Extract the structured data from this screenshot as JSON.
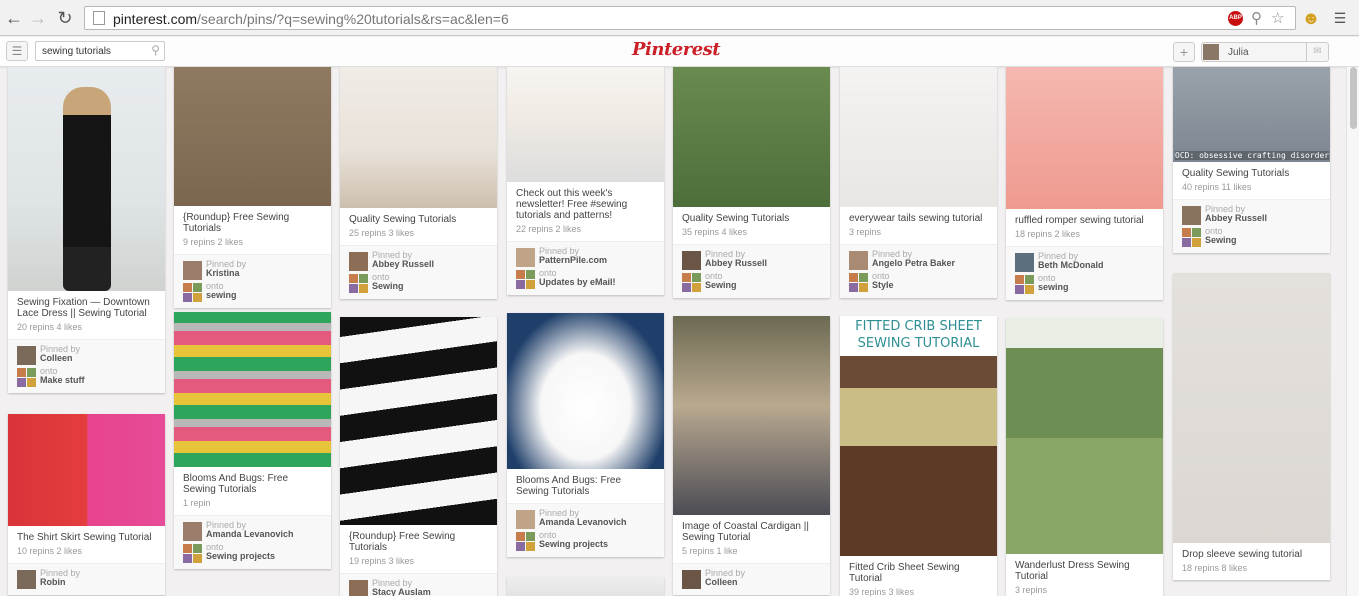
{
  "browser": {
    "url_host": "pinterest.com",
    "url_path": "/search/pins/?q=sewing%20tutorials&rs=ac&len=6",
    "adblock_badge": "ABP",
    "icons": [
      "back-arrow-icon",
      "forward-arrow-icon",
      "reload-icon",
      "page-icon",
      "adblock-icon",
      "search-engine-icon",
      "bookmark-star-icon",
      "extension-icon",
      "menu-icon"
    ]
  },
  "header": {
    "search_value": "sewing tutorials",
    "logo": "Pinterest",
    "user_name": "Julia"
  },
  "labels": {
    "pinned_by": "Pinned by",
    "onto": "onto"
  },
  "colors": {
    "brand": "#cb2027",
    "background": "#f2f0f0"
  },
  "columns": [
    [
      {
        "desc": "Sewing Fixation — Downtown Lace Dress || Sewing Tutorial",
        "stats": "20 repins   4 likes",
        "pinner": "Colleen",
        "board": "Make stuff"
      },
      {
        "desc": "The Shirt Skirt Sewing Tutorial",
        "stats": "10 repins   2 likes",
        "pinner": "Robin",
        "board": ""
      }
    ],
    [
      {
        "desc": "{Roundup} Free Sewing Tutorials",
        "stats": "9 repins   2 likes",
        "pinner": "Kristina",
        "board": "sewing"
      },
      {
        "desc": "Blooms And Bugs: Free Sewing Tutorials",
        "stats": "1 repin",
        "pinner": "Amanda Levanovich",
        "board": "Sewing projects"
      }
    ],
    [
      {
        "desc": "Quality Sewing Tutorials",
        "stats": "25 repins   3 likes",
        "pinner": "Abbey Russell",
        "board": "Sewing"
      },
      {
        "desc": "{Roundup} Free Sewing Tutorials",
        "stats": "19 repins   3 likes",
        "pinner": "Stacy Auslam",
        "board": ""
      }
    ],
    [
      {
        "desc": "Check out this week's newsletter! Free #sewing tutorials and patterns!",
        "stats": "22 repins   2 likes",
        "pinner": "PatternPile.com",
        "board": "Updates by eMail!"
      },
      {
        "desc": "Blooms And Bugs: Free Sewing Tutorials",
        "stats": "",
        "pinner": "Amanda Levanovich",
        "board": "Sewing projects"
      }
    ],
    [
      {
        "desc": "Quality Sewing Tutorials",
        "stats": "35 repins   4 likes",
        "pinner": "Abbey Russell",
        "board": "Sewing"
      },
      {
        "desc": "Image of Coastal Cardigan || Sewing Tutorial",
        "stats": "5 repins   1 like",
        "pinner": "Colleen",
        "board": ""
      }
    ],
    [
      {
        "desc": "everywear tails sewing tutorial",
        "stats": "3 repins",
        "pinner": "Angelo Petra Baker",
        "board": "Style"
      },
      {
        "desc": "Fitted Crib Sheet Sewing Tutorial",
        "stats": "39 repins   3 likes",
        "pinner": "",
        "board": "",
        "overlay_title": "FITTED CRIB SHEET SEWING TUTORIAL"
      }
    ],
    [
      {
        "desc": "ruffled romper sewing tutorial",
        "stats": "18 repins   2 likes",
        "pinner": "Beth McDonald",
        "board": "sewing"
      },
      {
        "desc": "Wanderlust Dress Sewing Tutorial",
        "stats": "3 repins",
        "pinner": "",
        "board": ""
      }
    ],
    [
      {
        "desc": "Quality Sewing Tutorials",
        "stats": "40 repins   11 likes",
        "pinner": "Abbey Russell",
        "board": "Sewing",
        "overlay_title": "OCD: obsessive crafting disorder"
      },
      {
        "desc": "Drop sleeve sewing tutorial",
        "stats": "18 repins   8 likes",
        "pinner": "",
        "board": ""
      }
    ]
  ]
}
